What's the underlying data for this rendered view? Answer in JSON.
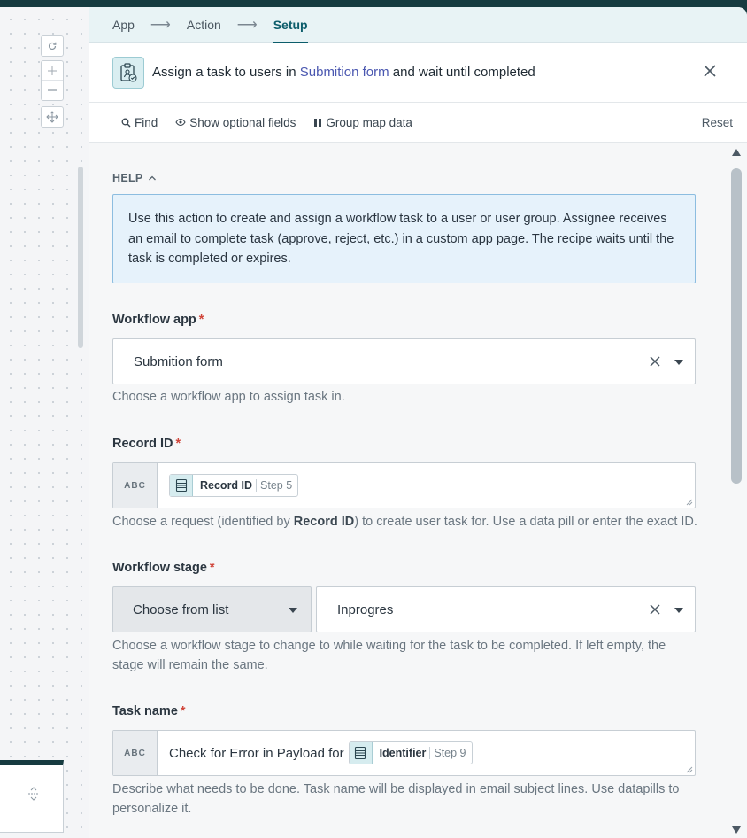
{
  "breadcrumbs": [
    {
      "label": "App"
    },
    {
      "label": "Action"
    },
    {
      "label": "Setup"
    }
  ],
  "header": {
    "title_prefix": "Assign a task to users in ",
    "title_link": "Submition form",
    "title_suffix": " and wait until completed"
  },
  "toolbar": {
    "find": "Find",
    "optional": "Show optional fields",
    "group": "Group map data",
    "reset": "Reset"
  },
  "help": {
    "label": "HELP",
    "text": "Use this action to create and assign a workflow task to a user or user group. Assignee receives an email to complete task (approve, reject, etc.) in a custom app page. The recipe waits until the task is completed or expires."
  },
  "fields": {
    "workflow_app": {
      "label": "Workflow app",
      "required": "*",
      "value": "Submition form",
      "hint": "Choose a workflow app to assign task in."
    },
    "record_id": {
      "label": "Record ID",
      "required": "*",
      "type_badge": "ABC",
      "pill_name": "Record ID",
      "pill_step": "Step 5",
      "hint_prefix": "Choose a request (identified by ",
      "hint_bold": "Record ID",
      "hint_suffix": ") to create user task for. Use a data pill or enter the exact ID."
    },
    "workflow_stage": {
      "label": "Workflow stage",
      "required": "*",
      "mode": "Choose from list",
      "value": "Inprogres",
      "hint": "Choose a workflow stage to change to while waiting for the task to be completed. If left empty, the stage will remain the same."
    },
    "task_name": {
      "label": "Task name",
      "required": "*",
      "type_badge": "ABC",
      "text": "Check for Error in Payload for",
      "pill_name": "Identifier",
      "pill_step": "Step 9",
      "hint": "Describe what needs to be done. Task name will be displayed in email subject lines. Use datapills to personalize it."
    }
  },
  "colors": {
    "accent": "#0c5d6b",
    "link": "#4a57b0",
    "required": "#d0453a",
    "help_bg": "#e6f2fb"
  }
}
